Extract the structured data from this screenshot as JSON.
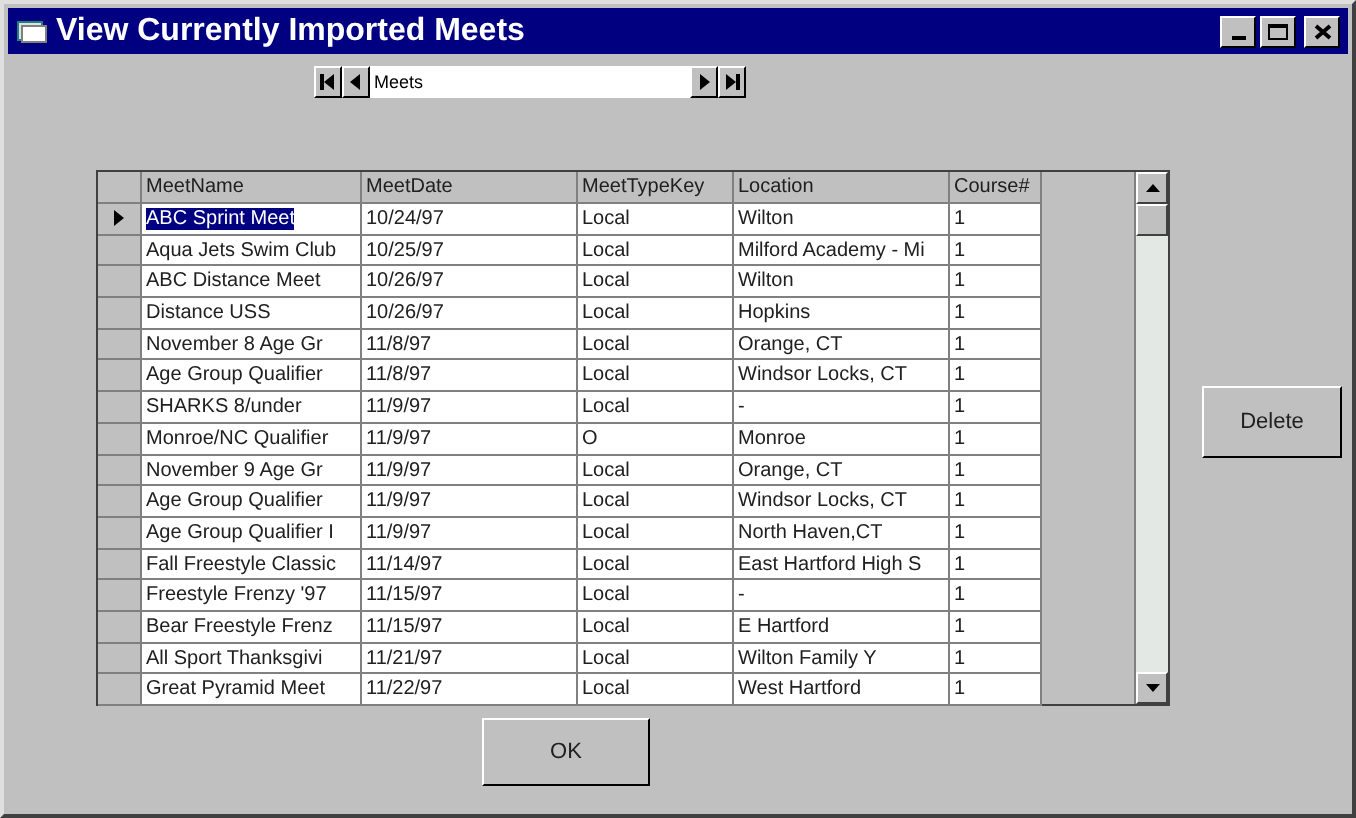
{
  "window": {
    "title": "View Currently Imported Meets"
  },
  "navigator": {
    "caption": "Meets"
  },
  "table": {
    "columns": [
      "MeetName",
      "MeetDate",
      "MeetTypeKey",
      "Location",
      "Course#"
    ],
    "rows": [
      {
        "cells": [
          "ABC Sprint Meet",
          "10/24/97",
          "Local",
          "Wilton",
          "1"
        ],
        "selected": true
      },
      {
        "cells": [
          "Aqua Jets Swim Club",
          "10/25/97",
          "Local",
          "Milford Academy - Mi",
          "1"
        ],
        "selected": false
      },
      {
        "cells": [
          "ABC Distance Meet",
          "10/26/97",
          "Local",
          "Wilton",
          "1"
        ],
        "selected": false
      },
      {
        "cells": [
          "Distance USS",
          "10/26/97",
          "Local",
          "Hopkins",
          "1"
        ],
        "selected": false
      },
      {
        "cells": [
          "November 8 Age Gr",
          "11/8/97",
          "Local",
          "Orange, CT",
          "1"
        ],
        "selected": false
      },
      {
        "cells": [
          "Age Group Qualifier",
          "11/8/97",
          "Local",
          "Windsor Locks, CT",
          "1"
        ],
        "selected": false
      },
      {
        "cells": [
          "SHARKS 8/under",
          "11/9/97",
          "Local",
          "-",
          "1"
        ],
        "selected": false
      },
      {
        "cells": [
          "Monroe/NC Qualifier",
          "11/9/97",
          "O",
          "Monroe",
          "1"
        ],
        "selected": false
      },
      {
        "cells": [
          "November 9 Age Gr",
          "11/9/97",
          "Local",
          "Orange, CT",
          "1"
        ],
        "selected": false
      },
      {
        "cells": [
          "Age Group Qualifier",
          "11/9/97",
          "Local",
          "Windsor Locks, CT",
          "1"
        ],
        "selected": false
      },
      {
        "cells": [
          "Age Group Qualifier I",
          "11/9/97",
          "Local",
          "North Haven,CT",
          "1"
        ],
        "selected": false
      },
      {
        "cells": [
          "Fall Freestyle Classic",
          "11/14/97",
          "Local",
          "East Hartford High S",
          "1"
        ],
        "selected": false
      },
      {
        "cells": [
          "Freestyle Frenzy '97",
          "11/15/97",
          "Local",
          "-",
          "1"
        ],
        "selected": false
      },
      {
        "cells": [
          "Bear Freestyle Frenz",
          "11/15/97",
          "Local",
          "E Hartford",
          "1"
        ],
        "selected": false
      },
      {
        "cells": [
          "All Sport Thanksgivi",
          "11/21/97",
          "Local",
          "Wilton Family Y",
          "1"
        ],
        "selected": false
      },
      {
        "cells": [
          "Great Pyramid Meet",
          "11/22/97",
          "Local",
          "West Hartford",
          "1"
        ],
        "selected": false
      }
    ]
  },
  "buttons": {
    "delete": "Delete",
    "ok": "OK"
  }
}
